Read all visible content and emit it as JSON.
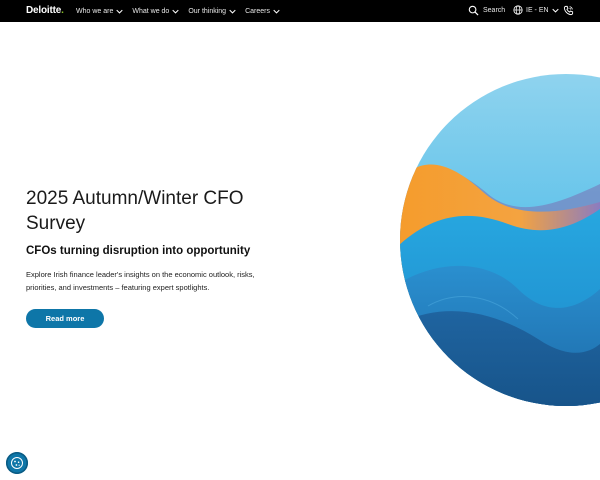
{
  "header": {
    "logo_text": "Deloitte",
    "logo_dot": ".",
    "nav": [
      {
        "label": "Who we are"
      },
      {
        "label": "What we do"
      },
      {
        "label": "Our thinking"
      },
      {
        "label": "Careers"
      }
    ],
    "search_label": "Search",
    "language_label": "IE - EN",
    "icons": {
      "search": "search-icon",
      "globe": "globe-icon",
      "contact": "phone-icon",
      "chevron": "chevron-down-icon"
    }
  },
  "hero": {
    "title": "2025 Autumn/Winter CFO Survey",
    "subtitle": "CFOs turning disruption into opportunity",
    "description": "Explore Irish finance leader's insights on the economic outlook, risks, priorities, and investments – featuring expert spotlights.",
    "cta_label": "Read more"
  },
  "cookie_settings": {
    "icon": "cookie-icon"
  },
  "colors": {
    "nav_bg": "#000000",
    "brand_green": "#86bc25",
    "cta_blue": "#0e76a8",
    "art_light_blue": "#8fd3ee",
    "art_orange": "#f4a340",
    "art_blue": "#1f8fd0",
    "art_dark_blue": "#1a5c93"
  }
}
